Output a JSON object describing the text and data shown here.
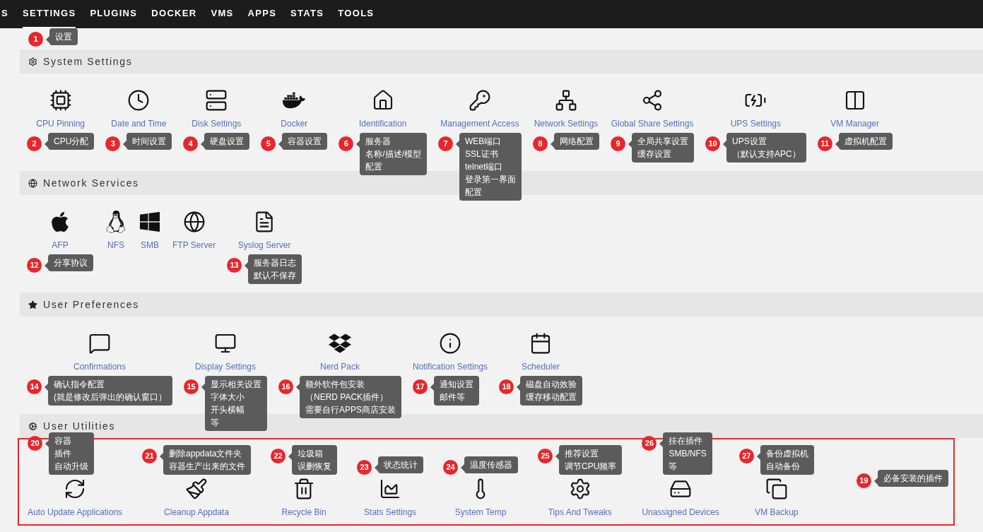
{
  "nav": [
    {
      "label": "S",
      "selected": false
    },
    {
      "label": "SETTINGS",
      "selected": true,
      "callout": {
        "number": "1",
        "lines": [
          "设置"
        ]
      }
    },
    {
      "label": "PLUGINS",
      "selected": false
    },
    {
      "label": "DOCKER",
      "selected": false
    },
    {
      "label": "VMS",
      "selected": false
    },
    {
      "label": "APPS",
      "selected": false
    },
    {
      "label": "STATS",
      "selected": false
    },
    {
      "label": "TOOLS",
      "selected": false
    }
  ],
  "sections": [
    {
      "title": "System Settings",
      "highlighted": false,
      "items": [
        {
          "label": "CPU Pinning",
          "callout": {
            "number": "2",
            "lines": [
              "CPU分配"
            ]
          }
        },
        {
          "label": "Date and Time",
          "callout": {
            "number": "3",
            "lines": [
              "时间设置"
            ]
          }
        },
        {
          "label": "Disk Settings",
          "callout": {
            "number": "4",
            "lines": [
              "硬盘设置"
            ]
          }
        },
        {
          "label": "Docker",
          "callout": {
            "number": "5",
            "lines": [
              "容器设置"
            ]
          }
        },
        {
          "label": "Identification",
          "callout": {
            "number": "6",
            "lines": [
              "服务器",
              "名称/描述/模型",
              "配置"
            ]
          }
        },
        {
          "label": "Management Access",
          "callout": {
            "number": "7",
            "lines": [
              "WEB端口",
              "SSL证书",
              "telnet端口",
              "登录第一界面",
              "配置"
            ]
          }
        },
        {
          "label": "Network Settings",
          "callout": {
            "number": "8",
            "lines": [
              "网络配置"
            ]
          }
        },
        {
          "label": "Global Share Settings",
          "callout": {
            "number": "9",
            "lines": [
              "全局共享设置",
              "缓存设置"
            ]
          }
        },
        {
          "label": "UPS Settings",
          "callout": {
            "number": "10",
            "lines": [
              "UPS设置",
              "（默认支持APC）"
            ]
          }
        },
        {
          "label": "VM Manager",
          "callout": {
            "number": "11",
            "lines": [
              "虚拟机配置"
            ]
          }
        }
      ]
    },
    {
      "title": "Network Services",
      "highlighted": false,
      "items": [
        {
          "label": "AFP",
          "callout": {
            "number": "12",
            "lines": [
              "分享协议"
            ]
          }
        },
        {
          "label": "NFS"
        },
        {
          "label": "SMB"
        },
        {
          "label": "FTP Server"
        },
        {
          "label": "Syslog Server",
          "callout": {
            "number": "13",
            "lines": [
              "服务器日志",
              "默认不保存"
            ]
          }
        }
      ]
    },
    {
      "title": "User Preferences",
      "highlighted": false,
      "items": [
        {
          "label": "Confirmations",
          "callout": {
            "number": "14",
            "lines": [
              "确认指令配置",
              "(就是修改后弹出的确认窗口）"
            ]
          }
        },
        {
          "label": "Display Settings",
          "callout": {
            "number": "15",
            "lines": [
              "显示相关设置",
              "字体大小",
              "开头横幅",
              "等"
            ]
          }
        },
        {
          "label": "Nerd Pack",
          "callout": {
            "number": "16",
            "lines": [
              "额外软件包安装",
              "（NERD PACK插件）",
              "需要自行APPS商店安装"
            ]
          }
        },
        {
          "label": "Notification Settings",
          "callout": {
            "number": "17",
            "lines": [
              "通知设置",
              "邮件等"
            ]
          }
        },
        {
          "label": "Scheduler",
          "callout": {
            "number": "18",
            "lines": [
              "磁盘自动效验",
              "缓存移动配置"
            ]
          }
        }
      ]
    },
    {
      "title": "User Utilities",
      "highlighted": true,
      "items": [
        {
          "label": "Auto Update Applications",
          "callout": {
            "number": "20",
            "lines": [
              "容器",
              "插件",
              "自动升级"
            ]
          }
        },
        {
          "label": "Cleanup Appdata",
          "callout": {
            "number": "21",
            "lines": [
              "删除appdata文件夹",
              "容器生产出来的文件"
            ]
          }
        },
        {
          "label": "Recycle Bin",
          "callout": {
            "number": "22",
            "lines": [
              "垃圾箱",
              "误删恢复"
            ]
          }
        },
        {
          "label": "Stats Settings",
          "callout": {
            "number": "23",
            "lines": [
              "状态统计"
            ]
          }
        },
        {
          "label": "System Temp",
          "callout": {
            "number": "24",
            "lines": [
              "温度传感器"
            ]
          }
        },
        {
          "label": "Tips And Tweaks",
          "callout": {
            "number": "25",
            "lines": [
              "推荐设置",
              "调节CPU频率"
            ]
          }
        },
        {
          "label": "Unassigned Devices",
          "callout": {
            "number": "26",
            "lines": [
              "挂在插件",
              "SMB/NFS",
              "等"
            ]
          }
        },
        {
          "label": "VM Backup",
          "callout": {
            "number": "27",
            "lines": [
              "备份虚拟机",
              "自动备份"
            ]
          }
        }
      ],
      "callouts": [
        {
          "number": "19",
          "lines": [
            "必备安装的插件"
          ]
        }
      ]
    }
  ]
}
